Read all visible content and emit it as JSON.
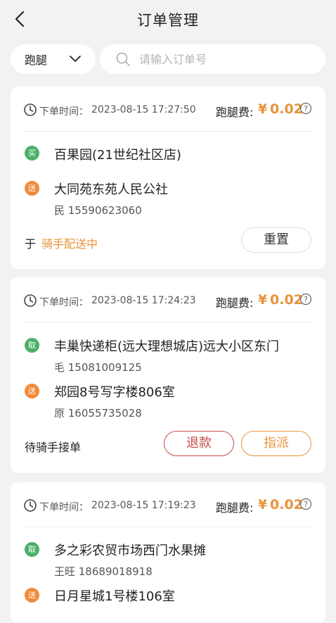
{
  "header": {
    "title": "订单管理"
  },
  "filter": {
    "type_selected": "跑腿",
    "search_placeholder": "请输入订单号"
  },
  "colors": {
    "accent": "#e8943a",
    "pickup_badge": "#4caf6a",
    "delivery_badge": "#f08a3a",
    "refund": "#c94a4a"
  },
  "orders": [
    {
      "time_label": "下单时间：",
      "time": "2023-08-15 17:27:50",
      "fee_label": "跑腿费:",
      "fee_symbol": "¥",
      "fee": "0.02",
      "pickup_badge": "买",
      "pickup_address": "百果园(21世纪社区店)",
      "delivery_badge": "送",
      "delivery_address": "大同苑东苑人民公社",
      "delivery_contact": "民 15590623060",
      "status_prefix": "于",
      "status": "骑手配送中",
      "buttons": [
        "重置"
      ]
    },
    {
      "time_label": "下单时间：",
      "time": "2023-08-15 17:24:23",
      "fee_label": "跑腿费:",
      "fee_symbol": "¥",
      "fee": "0.02",
      "pickup_badge": "取",
      "pickup_address": "丰巢快递柜(远大理想城店)远大小区东门",
      "pickup_contact": "毛 15081009125",
      "delivery_badge": "送",
      "delivery_address": "郑园8号写字楼806室",
      "delivery_contact": "原 16055735028",
      "status": "待骑手接单",
      "buttons": [
        "退款",
        "指派"
      ]
    },
    {
      "time_label": "下单时间：",
      "time": "2023-08-15 17:19:23",
      "fee_label": "跑腿费:",
      "fee_symbol": "¥",
      "fee": "0.02",
      "pickup_badge": "取",
      "pickup_address": "多之彩农贸市场西门水果摊",
      "pickup_contact": "王旺 18689018918",
      "delivery_badge": "送",
      "delivery_address": "日月星城1号楼106室"
    }
  ]
}
